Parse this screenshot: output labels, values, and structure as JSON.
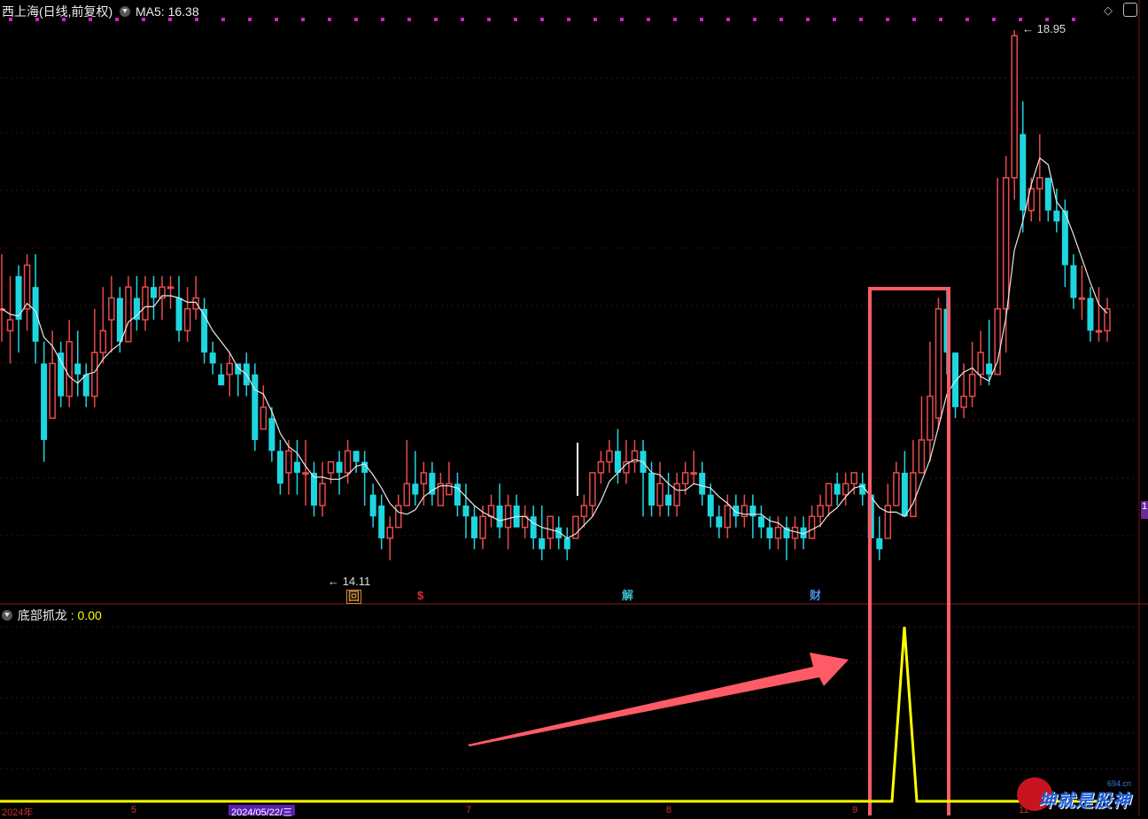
{
  "header": {
    "stock_name": "西上海(日线,前复权)",
    "ma_label": "MA5: 16.38"
  },
  "indicator": {
    "name": "底部抓龙",
    "value": ": 0.00"
  },
  "annotations": {
    "high_label": "18.95",
    "low_label": "14.11"
  },
  "event_markers": [
    {
      "glyph": "回",
      "color": "#d08a3c"
    },
    {
      "glyph": "$",
      "color": "#e03030"
    },
    {
      "glyph": "解",
      "color": "#39c1c9"
    },
    {
      "glyph": "财",
      "color": "#4b8be0"
    }
  ],
  "xaxis": {
    "year_label": "2024年",
    "month_labels": [
      "5",
      "7",
      "8",
      "9",
      "11"
    ],
    "cursor_date": "2024/05/22/三"
  },
  "right_edge_label": "1",
  "watermark": {
    "text": "坤就是股神",
    "sub": "694.cn"
  },
  "colors": {
    "up": "#e84a4a",
    "down": "#1ed6e0",
    "ma": "#e8e8e8",
    "indicator": "#ffff00",
    "grid": "#4a0d0d",
    "highlight_box": "#ff5b66",
    "dot_marks": "#d21ed2"
  },
  "chart_data": {
    "type": "candlestick",
    "candles": [
      [
        16.4,
        16.4,
        16.9,
        16.1
      ],
      [
        16.2,
        16.3,
        16.7,
        15.9
      ],
      [
        16.7,
        16.3,
        16.8,
        16.0
      ],
      [
        16.4,
        16.8,
        16.9,
        16.2
      ],
      [
        16.6,
        16.1,
        16.9,
        15.9
      ],
      [
        15.9,
        15.2,
        16.1,
        15.0
      ],
      [
        15.4,
        15.9,
        16.2,
        15.4
      ],
      [
        16.0,
        15.6,
        16.1,
        15.5
      ],
      [
        15.6,
        16.1,
        16.3,
        15.5
      ],
      [
        15.9,
        15.8,
        16.2,
        15.6
      ],
      [
        15.8,
        15.6,
        15.9,
        15.5
      ],
      [
        15.6,
        16.0,
        16.4,
        15.5
      ],
      [
        16.0,
        16.2,
        16.6,
        15.9
      ],
      [
        16.3,
        16.5,
        16.7,
        16.0
      ],
      [
        16.5,
        16.1,
        16.6,
        16.0
      ],
      [
        16.1,
        16.6,
        16.7,
        16.1
      ],
      [
        16.5,
        16.3,
        16.7,
        16.2
      ],
      [
        16.3,
        16.6,
        16.7,
        16.2
      ],
      [
        16.6,
        16.5,
        16.7,
        16.3
      ],
      [
        16.5,
        16.6,
        16.7,
        16.3
      ],
      [
        16.6,
        16.6,
        16.7,
        16.4
      ],
      [
        16.5,
        16.2,
        16.7,
        16.1
      ],
      [
        16.2,
        16.4,
        16.6,
        16.1
      ],
      [
        16.4,
        16.5,
        16.7,
        16.3
      ],
      [
        16.4,
        16.0,
        16.5,
        15.9
      ],
      [
        16.0,
        15.9,
        16.1,
        15.8
      ],
      [
        15.8,
        15.7,
        15.9,
        15.7
      ],
      [
        15.8,
        15.9,
        16.0,
        15.6
      ],
      [
        15.9,
        15.8,
        15.9,
        15.6
      ],
      [
        15.9,
        15.7,
        16.0,
        15.6
      ],
      [
        15.8,
        15.2,
        15.9,
        15.1
      ],
      [
        15.3,
        15.5,
        15.7,
        15.3
      ],
      [
        15.4,
        15.1,
        15.5,
        15.0
      ],
      [
        15.1,
        14.8,
        15.2,
        14.7
      ],
      [
        14.9,
        15.1,
        15.2,
        14.7
      ],
      [
        15.0,
        14.9,
        15.2,
        14.7
      ],
      [
        14.9,
        14.9,
        15.2,
        14.6
      ],
      [
        14.9,
        14.6,
        15.0,
        14.5
      ],
      [
        14.6,
        14.8,
        15.0,
        14.5
      ],
      [
        14.9,
        15.0,
        15.0,
        14.8
      ],
      [
        15.0,
        14.9,
        15.1,
        14.7
      ],
      [
        14.9,
        15.1,
        15.2,
        14.8
      ],
      [
        15.1,
        15.0,
        15.1,
        14.9
      ],
      [
        15.0,
        14.9,
        15.1,
        14.6
      ],
      [
        14.7,
        14.5,
        14.8,
        14.4
      ],
      [
        14.6,
        14.3,
        14.7,
        14.2
      ],
      [
        14.3,
        14.4,
        14.5,
        14.1
      ],
      [
        14.4,
        14.6,
        14.7,
        14.4
      ],
      [
        14.6,
        14.8,
        15.2,
        14.6
      ],
      [
        14.8,
        14.7,
        15.1,
        14.6
      ],
      [
        14.8,
        14.9,
        15.0,
        14.6
      ],
      [
        14.9,
        14.7,
        15.0,
        14.6
      ],
      [
        14.6,
        14.8,
        14.9,
        14.6
      ],
      [
        14.7,
        14.8,
        15.0,
        14.7
      ],
      [
        14.8,
        14.6,
        14.9,
        14.5
      ],
      [
        14.6,
        14.5,
        14.8,
        14.3
      ],
      [
        14.5,
        14.3,
        14.6,
        14.2
      ],
      [
        14.3,
        14.5,
        14.6,
        14.2
      ],
      [
        14.5,
        14.6,
        14.7,
        14.4
      ],
      [
        14.6,
        14.4,
        14.8,
        14.3
      ],
      [
        14.4,
        14.6,
        14.7,
        14.2
      ],
      [
        14.6,
        14.4,
        14.7,
        14.4
      ],
      [
        14.4,
        14.5,
        14.6,
        14.3
      ],
      [
        14.5,
        14.3,
        14.6,
        14.2
      ],
      [
        14.3,
        14.2,
        14.6,
        14.1
      ],
      [
        14.3,
        14.5,
        14.5,
        14.2
      ],
      [
        14.4,
        14.3,
        14.5,
        14.2
      ],
      [
        14.3,
        14.2,
        14.4,
        14.1
      ],
      [
        14.3,
        14.5,
        14.5,
        14.3
      ],
      [
        14.5,
        14.6,
        14.7,
        14.4
      ],
      [
        14.6,
        14.9,
        14.9,
        14.5
      ],
      [
        14.9,
        15.0,
        15.1,
        14.8
      ],
      [
        15.0,
        15.1,
        15.2,
        14.9
      ],
      [
        15.1,
        14.9,
        15.3,
        14.8
      ],
      [
        14.9,
        15.0,
        15.2,
        14.8
      ],
      [
        15.0,
        15.1,
        15.2,
        14.9
      ],
      [
        15.1,
        14.9,
        15.2,
        14.5
      ],
      [
        14.9,
        14.6,
        15.0,
        14.5
      ],
      [
        14.6,
        14.8,
        15.0,
        14.5
      ],
      [
        14.7,
        14.6,
        14.9,
        14.5
      ],
      [
        14.6,
        14.8,
        14.9,
        14.5
      ],
      [
        14.8,
        14.9,
        15.0,
        14.7
      ],
      [
        14.9,
        14.9,
        15.1,
        14.8
      ],
      [
        14.9,
        14.7,
        15.0,
        14.6
      ],
      [
        14.7,
        14.5,
        14.8,
        14.4
      ],
      [
        14.5,
        14.4,
        14.6,
        14.3
      ],
      [
        14.4,
        14.6,
        14.7,
        14.3
      ],
      [
        14.6,
        14.5,
        14.7,
        14.4
      ],
      [
        14.5,
        14.6,
        14.7,
        14.4
      ],
      [
        14.6,
        14.5,
        14.7,
        14.3
      ],
      [
        14.5,
        14.4,
        14.6,
        14.3
      ],
      [
        14.4,
        14.3,
        14.5,
        14.2
      ],
      [
        14.3,
        14.4,
        14.5,
        14.2
      ],
      [
        14.4,
        14.3,
        14.5,
        14.1
      ],
      [
        14.3,
        14.4,
        14.5,
        14.2
      ],
      [
        14.4,
        14.3,
        14.5,
        14.2
      ],
      [
        14.3,
        14.5,
        14.6,
        14.3
      ],
      [
        14.5,
        14.6,
        14.7,
        14.4
      ],
      [
        14.6,
        14.8,
        14.8,
        14.5
      ],
      [
        14.8,
        14.7,
        14.9,
        14.6
      ],
      [
        14.7,
        14.8,
        14.9,
        14.6
      ],
      [
        14.8,
        14.9,
        14.9,
        14.7
      ],
      [
        14.8,
        14.7,
        14.9,
        14.6
      ],
      [
        14.7,
        14.3,
        14.8,
        14.2
      ],
      [
        14.3,
        14.2,
        14.5,
        14.1
      ],
      [
        14.3,
        14.6,
        14.8,
        14.3
      ],
      [
        14.6,
        14.9,
        15.0,
        14.6
      ],
      [
        14.9,
        14.5,
        15.1,
        14.5
      ],
      [
        14.5,
        14.9,
        15.2,
        14.5
      ],
      [
        14.9,
        15.2,
        15.6,
        14.9
      ],
      [
        15.2,
        15.6,
        16.1,
        15.0
      ],
      [
        15.4,
        16.4,
        16.5,
        15.3
      ],
      [
        16.4,
        16.0,
        16.6,
        15.8
      ],
      [
        16.0,
        15.5,
        16.0,
        15.4
      ],
      [
        15.5,
        15.6,
        15.9,
        15.4
      ],
      [
        15.6,
        15.8,
        16.1,
        15.5
      ],
      [
        15.8,
        16.0,
        16.2,
        15.7
      ],
      [
        15.9,
        15.8,
        16.3,
        15.7
      ],
      [
        15.8,
        16.4,
        17.6,
        15.8
      ],
      [
        16.4,
        17.6,
        17.8,
        16.0
      ],
      [
        17.6,
        18.9,
        18.95,
        17.4
      ],
      [
        18.0,
        17.3,
        18.3,
        17.1
      ],
      [
        17.3,
        17.5,
        17.6,
        17.2
      ],
      [
        17.5,
        17.6,
        18.0,
        17.2
      ],
      [
        17.6,
        17.3,
        17.6,
        17.2
      ],
      [
        17.3,
        17.2,
        17.5,
        17.1
      ],
      [
        17.3,
        16.8,
        17.4,
        16.6
      ],
      [
        16.8,
        16.5,
        16.9,
        16.4
      ],
      [
        16.5,
        16.5,
        16.8,
        16.3
      ],
      [
        16.5,
        16.2,
        16.6,
        16.1
      ],
      [
        16.2,
        16.2,
        16.6,
        16.1
      ],
      [
        16.2,
        16.4,
        16.5,
        16.1
      ]
    ],
    "ma5": true,
    "indicator_spike_value": 1,
    "high": 18.95,
    "low": 14.11,
    "ylim": [
      14.0,
      19.0
    ]
  }
}
